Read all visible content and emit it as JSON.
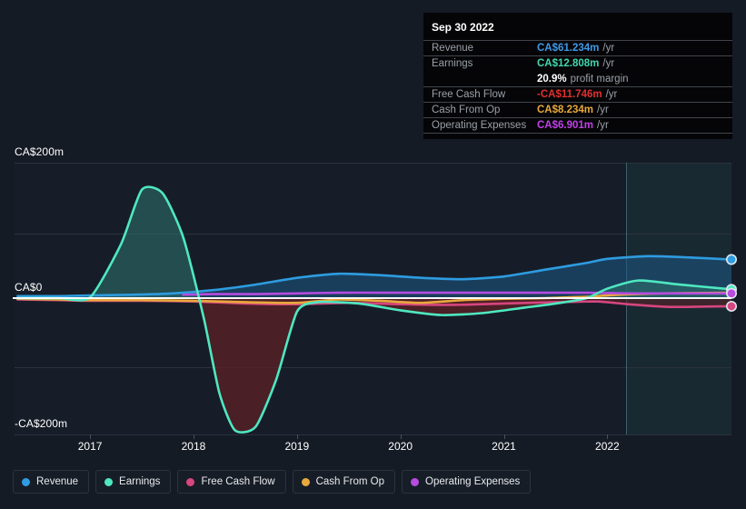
{
  "chart_data": {
    "type": "area",
    "title": "",
    "xlabel": "",
    "ylabel": "",
    "grid": true,
    "legend_position": "bottom",
    "currency": "CA$",
    "ylim": [
      -200,
      200
    ],
    "y_ticks": [
      "CA$200m",
      "CA$0",
      "-CA$200m"
    ],
    "y_tick_values": [
      200,
      0,
      -200
    ],
    "x_ticks": [
      "2017",
      "2018",
      "2019",
      "2020",
      "2021",
      "2022"
    ],
    "x_tick_values": [
      2017,
      2018,
      2019,
      2020,
      2021,
      2022
    ],
    "forecast_start": "2022.0",
    "series": [
      {
        "name": "Revenue",
        "color": "#2e9ce0",
        "fill": "rgba(30,90,135,0.55)",
        "x": [
          2016.3,
          2016.7,
          2017.0,
          2017.4,
          2017.8,
          2018.2,
          2018.6,
          2019.0,
          2019.4,
          2019.8,
          2020.2,
          2020.6,
          2021.0,
          2021.4,
          2021.8,
          2022.0,
          2022.4,
          2022.8,
          2023.2
        ],
        "values": [
          3,
          3,
          4,
          5,
          7,
          12,
          20,
          30,
          36,
          34,
          30,
          28,
          32,
          42,
          52,
          58,
          62,
          60,
          57
        ]
      },
      {
        "name": "Earnings",
        "color": "#4ee8c0",
        "fill_positive": "rgba(45,110,105,0.6)",
        "fill_negative": "rgba(92,32,38,0.75)",
        "x": [
          2016.3,
          2016.7,
          2017.0,
          2017.3,
          2017.5,
          2017.7,
          2017.9,
          2018.1,
          2018.25,
          2018.4,
          2018.6,
          2018.8,
          2019.0,
          2019.2,
          2019.6,
          2020.0,
          2020.4,
          2020.8,
          2021.2,
          2021.5,
          2021.8,
          2022.0,
          2022.3,
          2022.7,
          2023.2
        ],
        "values": [
          0,
          0,
          1,
          80,
          160,
          155,
          90,
          -30,
          -140,
          -195,
          -190,
          -120,
          -20,
          -6,
          -8,
          -18,
          -25,
          -22,
          -14,
          -8,
          0,
          14,
          26,
          20,
          13
        ]
      },
      {
        "name": "Free Cash Flow",
        "color": "#d6467f",
        "fill": "rgba(92,32,38,0.55)",
        "x": [
          2016.3,
          2016.7,
          2017.0,
          2017.5,
          2018.0,
          2018.5,
          2019.0,
          2019.5,
          2020.0,
          2020.5,
          2021.0,
          2021.5,
          2021.9,
          2022.2,
          2022.6,
          2023.2
        ],
        "values": [
          -2,
          -3,
          -4,
          -4,
          -5,
          -8,
          -9,
          -7,
          -9,
          -10,
          -8,
          -6,
          -5,
          -9,
          -13,
          -12
        ]
      },
      {
        "name": "Cash From Op",
        "color": "#e8a93c",
        "x": [
          2016.3,
          2016.7,
          2017.0,
          2017.5,
          2018.0,
          2018.5,
          2019.0,
          2019.4,
          2019.8,
          2020.2,
          2020.6,
          2021.0,
          2021.4,
          2021.8,
          2022.1,
          2022.5,
          2023.2
        ],
        "values": [
          -1,
          -2,
          -3,
          -3,
          -4,
          -6,
          -7,
          -2,
          -4,
          -7,
          -3,
          -1,
          0,
          2,
          5,
          7,
          8
        ]
      },
      {
        "name": "Operating Expenses",
        "color": "#b64ce0",
        "x": [
          2017.9,
          2018.2,
          2018.6,
          2019.0,
          2019.4,
          2019.8,
          2020.2,
          2020.6,
          2021.0,
          2021.4,
          2021.8,
          2022.2,
          2022.7,
          2023.2
        ],
        "values": [
          5,
          6,
          6,
          7,
          8,
          8,
          8,
          8,
          8,
          8,
          8,
          7,
          7,
          7
        ]
      }
    ],
    "end_markers": [
      {
        "series": "Revenue",
        "color": "#2e9ce0"
      },
      {
        "series": "Earnings",
        "color": "#4ee8c0"
      },
      {
        "series": "Operating Expenses",
        "color": "#b64ce0"
      },
      {
        "series": "Free Cash Flow",
        "color": "#d6467f"
      }
    ]
  },
  "tooltip": {
    "date": "Sep 30 2022",
    "rows": [
      {
        "label": "Revenue",
        "value": "CA$61.234m",
        "unit": "/yr",
        "color": "#3d9ae8"
      },
      {
        "label": "Earnings",
        "value": "CA$12.808m",
        "unit": "/yr",
        "color": "#40d9b0"
      },
      {
        "label": "",
        "value": "20.9%",
        "unit": "profit margin",
        "color": "#ffffff"
      },
      {
        "label": "Free Cash Flow",
        "value": "-CA$11.746m",
        "unit": "/yr",
        "color": "#e03030"
      },
      {
        "label": "Cash From Op",
        "value": "CA$8.234m",
        "unit": "/yr",
        "color": "#e8a93c"
      },
      {
        "label": "Operating Expenses",
        "value": "CA$6.901m",
        "unit": "/yr",
        "color": "#c040e8"
      }
    ]
  },
  "legend": {
    "items": [
      {
        "label": "Revenue",
        "color": "#2e9ce0"
      },
      {
        "label": "Earnings",
        "color": "#4ee8c0"
      },
      {
        "label": "Free Cash Flow",
        "color": "#d6467f"
      },
      {
        "label": "Cash From Op",
        "color": "#e8a93c"
      },
      {
        "label": "Operating Expenses",
        "color": "#b64ce0"
      }
    ]
  }
}
